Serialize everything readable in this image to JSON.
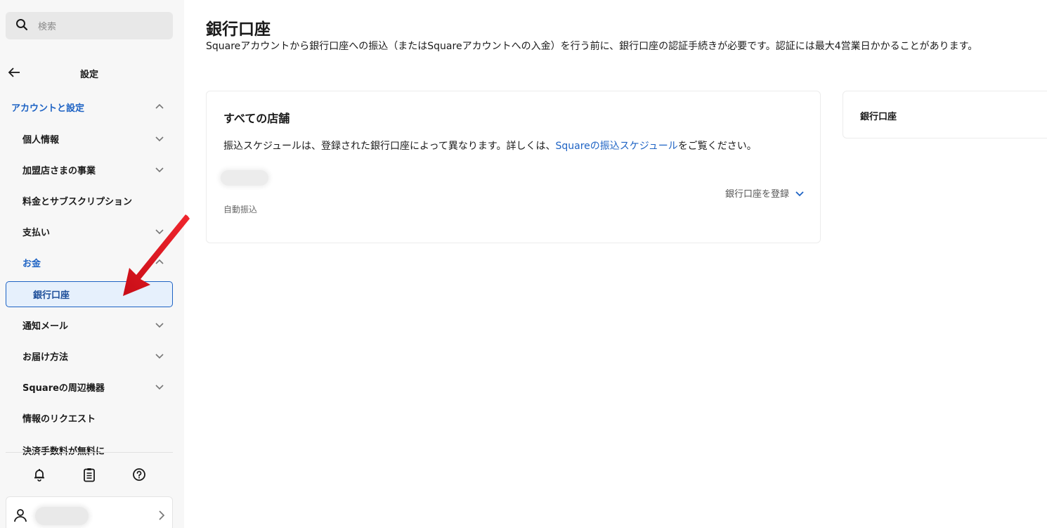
{
  "search": {
    "placeholder": "検索",
    "icon": "search-icon"
  },
  "settings_header": {
    "title": "設定",
    "back_icon": "arrow-left-icon"
  },
  "sidebar": {
    "section": {
      "label": "アカウントと設定",
      "expanded": true
    },
    "items": [
      {
        "label": "個人情報",
        "chevron": "down"
      },
      {
        "label": "加盟店さまの事業",
        "chevron": "down"
      },
      {
        "label": "料金とサブスクリプション",
        "chevron": ""
      },
      {
        "label": "支払い",
        "chevron": "down"
      },
      {
        "label": "お金",
        "chevron": "up"
      },
      {
        "label": "銀行口座",
        "selected": true
      },
      {
        "label": "通知メール",
        "chevron": "down"
      },
      {
        "label": "お届け方法",
        "chevron": "down"
      },
      {
        "label": "Squareの周辺機器",
        "chevron": "down"
      },
      {
        "label": "情報のリクエスト",
        "chevron": ""
      },
      {
        "label": "決済手数料が無料に",
        "chevron": ""
      }
    ],
    "footer_icons": [
      "bell-icon",
      "clipboard-icon",
      "help-icon"
    ],
    "account_icon": "person-icon"
  },
  "main": {
    "title": "銀行口座",
    "description": "Squareアカウントから銀行口座への振込（またはSquareアカウントへの入金）を行う前に、銀行口座の認証手続きが必要です。認証には最大4営業日かかることがあります。",
    "card": {
      "title": "すべての店舗",
      "desc_before": "振込スケジュールは、登録された銀行口座によって異なります。詳しくは、",
      "desc_link": "Squareの振込スケジュール",
      "desc_after": "をご覧ください。",
      "register_label": "銀行口座を登録",
      "auto_label": "自動振込"
    },
    "side_card": {
      "title": "銀行口座"
    }
  },
  "colors": {
    "accent": "#1e63c4",
    "selected_bg": "#e6f0fc",
    "annotation": "#e0141e"
  }
}
